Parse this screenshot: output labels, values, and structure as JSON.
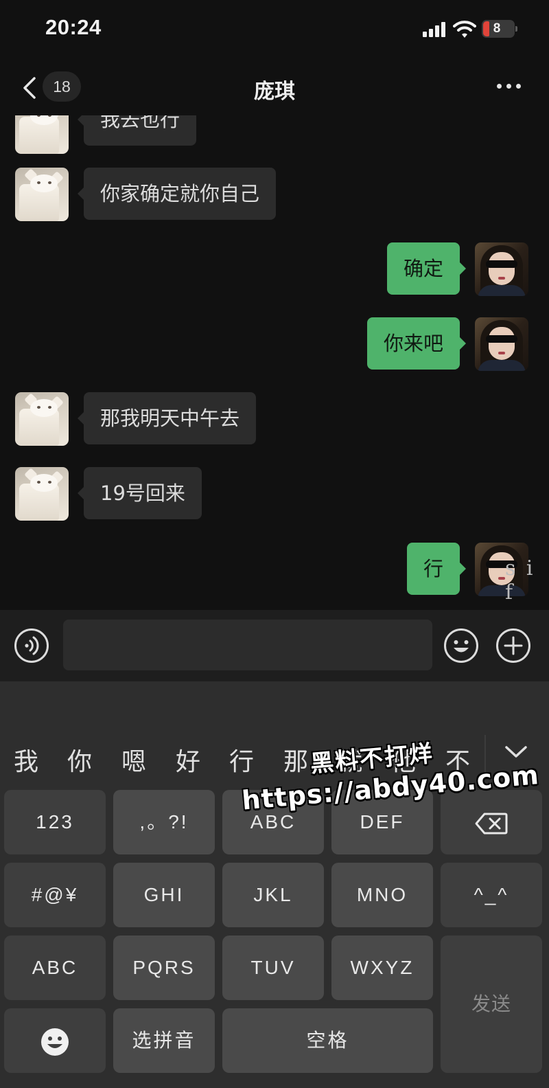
{
  "status_bar": {
    "time": "20:24",
    "battery_level": "8",
    "battery_color": "#e0443a"
  },
  "nav": {
    "unread_count": "18",
    "title": "庞琪"
  },
  "messages": [
    {
      "side": "in",
      "text": "我去也行"
    },
    {
      "side": "in",
      "text": "你家确定就你自己"
    },
    {
      "side": "out",
      "text": "确定"
    },
    {
      "side": "out",
      "text": "你来吧"
    },
    {
      "side": "in",
      "text": "那我明天中午去"
    },
    {
      "side": "in",
      "text": "19号回来"
    },
    {
      "side": "out",
      "text": "行"
    }
  ],
  "overlay_text": "s i f",
  "input": {
    "value": ""
  },
  "keyboard": {
    "candidates": [
      "我",
      "你",
      "嗯",
      "好",
      "行",
      "那",
      "就",
      "他",
      "不"
    ],
    "keys": {
      "num": "123",
      "punct": ",。?!",
      "abc_row1": "ABC",
      "def": "DEF",
      "symbols": "#@¥",
      "ghi": "GHI",
      "jkl": "JKL",
      "mno": "MNO",
      "kaomoji": "^_^",
      "abc": "ABC",
      "pqrs": "PQRS",
      "tuv": "TUV",
      "wxyz": "WXYZ",
      "send": "发送",
      "pinyin": "选拼音",
      "space": "空格"
    }
  },
  "watermark": {
    "line1": "黑料不打烊",
    "line2": "https://abdy40.com"
  },
  "colors": {
    "outgoing_bubble": "#4fb36b",
    "incoming_bubble": "#2c2c2c",
    "background": "#111111"
  }
}
